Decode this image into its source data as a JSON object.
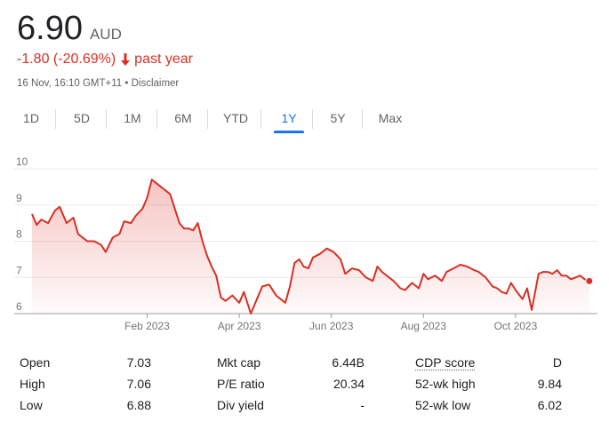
{
  "quote": {
    "price": "6.90",
    "currency": "AUD",
    "change": "-1.80 (-20.69%)",
    "period": "past year",
    "timestamp": "16 Nov, 16:10 GMT+11",
    "separator": "•",
    "disclaimer": "Disclaimer"
  },
  "colors": {
    "down": "#d93025",
    "accent": "#1a73e8",
    "muted": "#5f6368"
  },
  "tabs": [
    {
      "label": "1D"
    },
    {
      "label": "5D"
    },
    {
      "label": "1M"
    },
    {
      "label": "6M"
    },
    {
      "label": "YTD"
    },
    {
      "label": "1Y",
      "active": true
    },
    {
      "label": "5Y"
    },
    {
      "label": "Max"
    }
  ],
  "chart_data": {
    "type": "area",
    "y_ticks": [
      "10",
      "9",
      "8",
      "7",
      "6"
    ],
    "ylim": [
      6,
      10
    ],
    "x_ticks": [
      "Feb 2023",
      "Apr 2023",
      "Jun 2023",
      "Aug 2023",
      "Oct 2023"
    ],
    "x_tick_months": [
      2.5,
      4.5,
      6.5,
      8.5,
      10.5
    ],
    "xlim": [
      0,
      12.2
    ],
    "grid": true,
    "series": [
      {
        "x": [
          0,
          0.1,
          0.2,
          0.35,
          0.5,
          0.6,
          0.75,
          0.9,
          1.0,
          1.2,
          1.35,
          1.5,
          1.6,
          1.75,
          1.9,
          2.0,
          2.15,
          2.25,
          2.4,
          2.5,
          2.6,
          2.75,
          2.85,
          3.0,
          3.1,
          3.2,
          3.3,
          3.4,
          3.5,
          3.6,
          3.7,
          3.8,
          3.9,
          4.0,
          4.1,
          4.2,
          4.35,
          4.5,
          4.6,
          4.75,
          4.9,
          5.0,
          5.15,
          5.3,
          5.5,
          5.6,
          5.7,
          5.8,
          5.9,
          6.0,
          6.1,
          6.25,
          6.4,
          6.55,
          6.7,
          6.8,
          6.95,
          7.1,
          7.25,
          7.4,
          7.5,
          7.6,
          7.7,
          7.85,
          8.0,
          8.1,
          8.25,
          8.4,
          8.5,
          8.6,
          8.75,
          8.9,
          9.0,
          9.15,
          9.3,
          9.45,
          9.6,
          9.7,
          9.85,
          10.0,
          10.1,
          10.2,
          10.3,
          10.4,
          10.5,
          10.65,
          10.75,
          10.85,
          11.0,
          11.1,
          11.2,
          11.3,
          11.4,
          11.5,
          11.6,
          11.7,
          11.8,
          11.9,
          12.0,
          12.1
        ],
        "y": [
          8.75,
          8.45,
          8.6,
          8.5,
          8.85,
          8.95,
          8.5,
          8.65,
          8.2,
          8.0,
          8.0,
          7.9,
          7.7,
          8.1,
          8.2,
          8.55,
          8.5,
          8.7,
          8.9,
          9.2,
          9.7,
          9.55,
          9.45,
          9.3,
          8.9,
          8.5,
          8.35,
          8.35,
          8.3,
          8.5,
          8.0,
          7.6,
          7.3,
          7.05,
          6.45,
          6.35,
          6.5,
          6.3,
          6.6,
          6.0,
          6.45,
          6.75,
          6.8,
          6.5,
          6.3,
          6.75,
          7.4,
          7.5,
          7.3,
          7.25,
          7.55,
          7.65,
          7.8,
          7.7,
          7.5,
          7.1,
          7.25,
          7.2,
          7.0,
          6.9,
          7.3,
          7.15,
          7.05,
          6.9,
          6.7,
          6.65,
          6.85,
          6.7,
          7.1,
          6.95,
          7.05,
          6.9,
          7.15,
          7.25,
          7.35,
          7.3,
          7.2,
          7.15,
          7.0,
          6.75,
          6.7,
          6.6,
          6.55,
          6.85,
          6.65,
          6.4,
          6.7,
          6.1,
          7.1,
          7.15,
          7.15,
          7.1,
          7.2,
          7.05,
          7.05,
          6.95,
          7.0,
          7.05,
          6.95,
          6.9
        ]
      }
    ],
    "last_point": {
      "x": 12.1,
      "y": 6.9
    }
  },
  "stats": [
    [
      {
        "label": "Open",
        "value": "7.03"
      },
      {
        "label": "Mkt cap",
        "value": "6.44B"
      },
      {
        "label": "CDP score",
        "value": "D"
      }
    ],
    [
      {
        "label": "High",
        "value": "7.06"
      },
      {
        "label": "P/E ratio",
        "value": "20.34"
      },
      {
        "label": "52-wk high",
        "value": "9.84"
      }
    ],
    [
      {
        "label": "Low",
        "value": "6.88"
      },
      {
        "label": "Div yield",
        "value": "-"
      },
      {
        "label": "52-wk low",
        "value": "6.02"
      }
    ]
  ]
}
